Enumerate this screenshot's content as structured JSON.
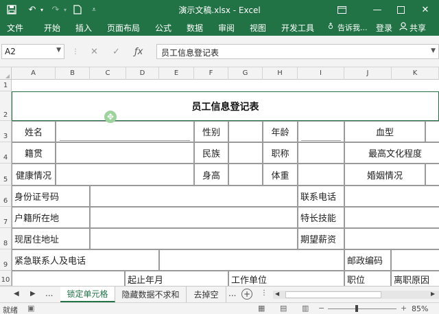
{
  "window": {
    "title": "演示文稿.xlsx - Excel",
    "save_icon": "save-icon",
    "undo_icon": "undo-icon",
    "redo_icon": "redo-icon",
    "new_icon": "new-file-icon",
    "customize_icon": "customize-icon"
  },
  "ribbon": {
    "tabs": [
      "文件",
      "开始",
      "插入",
      "页面布局",
      "公式",
      "数据",
      "审阅",
      "视图",
      "开发工具"
    ],
    "tell_me": "告诉我...",
    "login": "登录",
    "share": "共享",
    "accent_color": "#217346"
  },
  "formula_bar": {
    "name_box": "A2",
    "content": "员工信息登记表"
  },
  "columns": [
    "A",
    "B",
    "C",
    "D",
    "E",
    "F",
    "G",
    "H",
    "I",
    "J",
    "K"
  ],
  "rows": [
    "1",
    "2",
    "3",
    "4",
    "5",
    "6",
    "7",
    "8",
    "9",
    "10"
  ],
  "form": {
    "title": "员工信息登记表",
    "name": "姓名",
    "gender": "性别",
    "age": "年龄",
    "blood_type": "血型",
    "native_place": "籍贯",
    "ethnicity": "民族",
    "job_title": "职称",
    "education": "最高文化程度",
    "health": "健康情况",
    "height": "身高",
    "weight": "体重",
    "marriage": "婚姻情况",
    "id_number": "身份证号码",
    "phone": "联系电话",
    "household": "户籍所在地",
    "skills": "特长技能",
    "residence": "现居住地址",
    "expected_salary": "期望薪资",
    "emergency": "紧急联系人及电话",
    "postcode": "邮政编码",
    "period": "起止年月",
    "employer": "工作单位",
    "position": "职位",
    "leave_reason": "离职原因"
  },
  "sheets": {
    "more_left": "...",
    "tabs": [
      "锁定单元格",
      "隐藏数据不求和",
      "去掉空"
    ],
    "active_index": 0,
    "more_right": "..."
  },
  "status": {
    "ready": "就绪",
    "zoom": "85%"
  }
}
